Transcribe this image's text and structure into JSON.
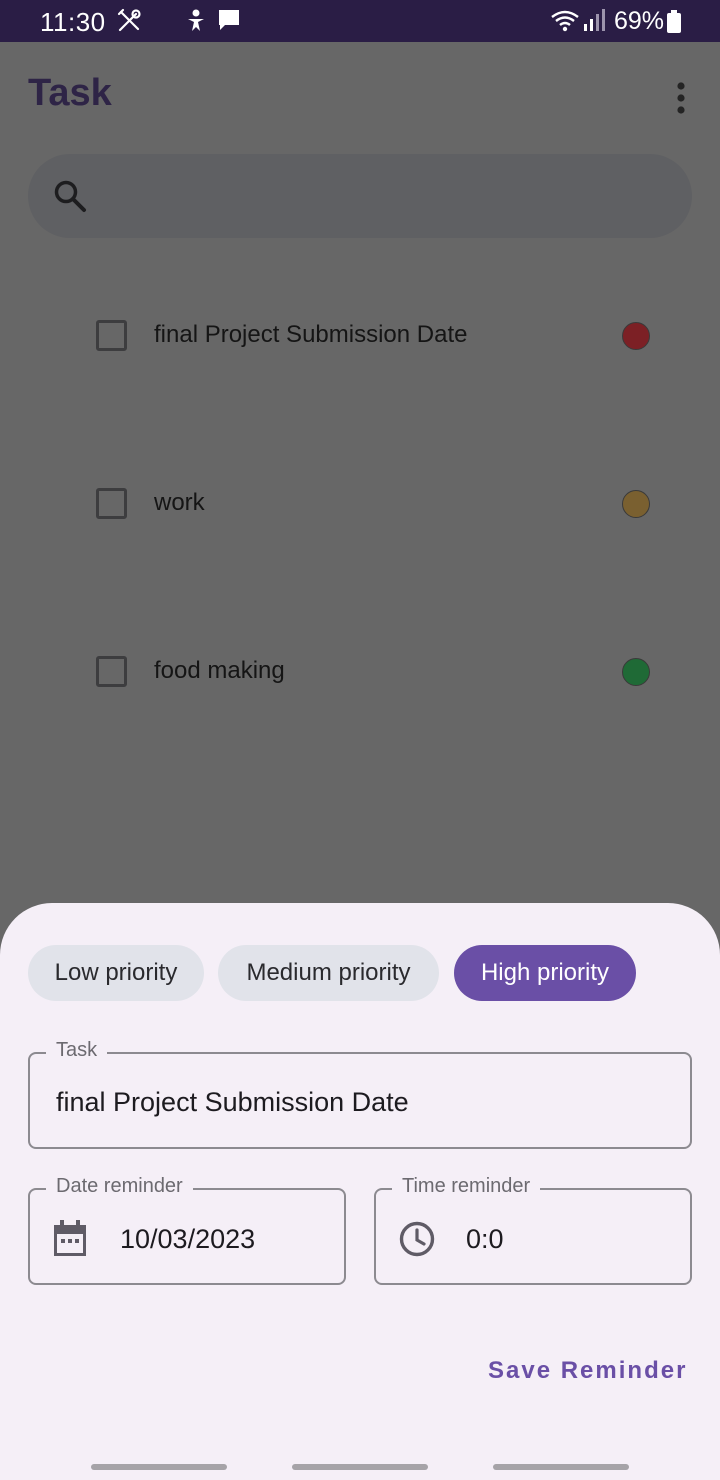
{
  "status_bar": {
    "time": "11:30",
    "battery": "69%",
    "icons": [
      "tools-icon",
      "accessibility-icon",
      "chat-icon",
      "wifi-icon",
      "signal-icon",
      "battery-icon"
    ]
  },
  "app_bar": {
    "title": "Task",
    "menu_icon": "more-vert-icon"
  },
  "search": {
    "placeholder": "",
    "icon": "search-icon"
  },
  "tasks": [
    {
      "label": "final Project Submission Date",
      "checked": false,
      "priority_color": "#7c2025"
    },
    {
      "label": "work",
      "checked": false,
      "priority_color": "#7a6030"
    },
    {
      "label": "food making",
      "checked": false,
      "priority_color": "#1f6a36"
    }
  ],
  "sheet": {
    "priorities": [
      {
        "label": "Low priority",
        "selected": false
      },
      {
        "label": "Medium priority",
        "selected": false
      },
      {
        "label": "High priority",
        "selected": true
      }
    ],
    "task_field": {
      "label": "Task",
      "value": "final Project Submission Date"
    },
    "date_field": {
      "label": "Date reminder",
      "value": "10/03/2023",
      "icon": "calendar-icon"
    },
    "time_field": {
      "label": "Time reminder",
      "value": "0:0",
      "icon": "clock-icon"
    },
    "save_label": "Save Reminder"
  },
  "colors": {
    "accent": "#6a4fa6",
    "status_bar": "#2a1d45",
    "scrim": "#676767",
    "sheet": "#f5eff7"
  }
}
